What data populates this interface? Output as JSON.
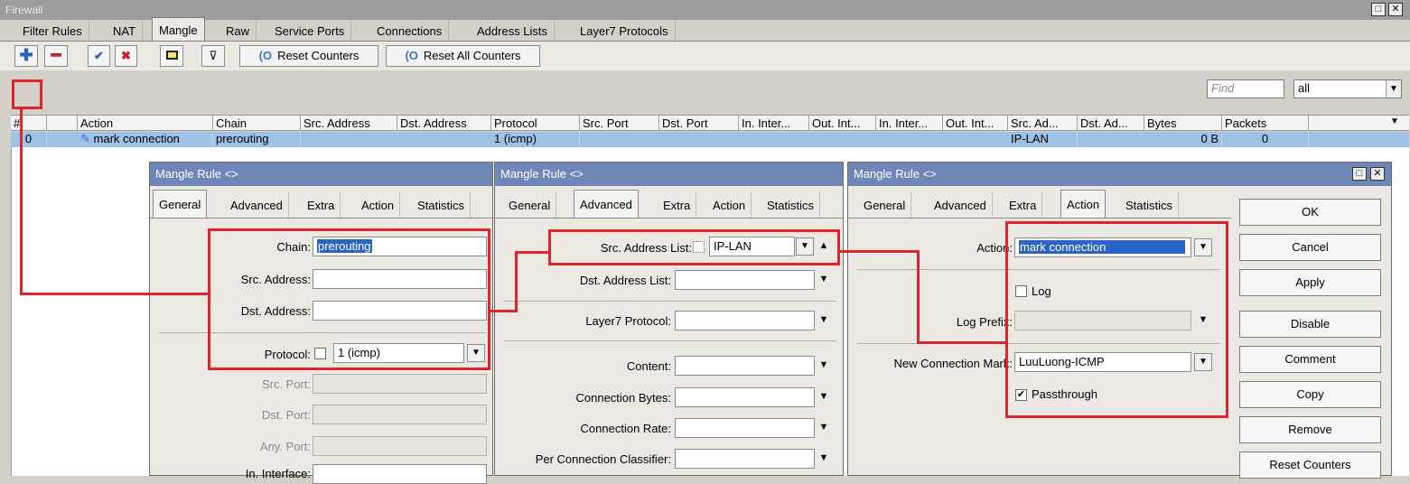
{
  "window": {
    "title": "Firewall",
    "restore_icon": "restore-icon",
    "close_icon": "close-icon"
  },
  "tabs": [
    "Filter Rules",
    "NAT",
    "Mangle",
    "Raw",
    "Service Ports",
    "Connections",
    "Address Lists",
    "Layer7 Protocols"
  ],
  "active_tab": "Mangle",
  "toolbar": {
    "reset_counters": "Reset Counters",
    "reset_all_counters": "Reset All Counters",
    "find_placeholder": "Find",
    "filter_value": "all"
  },
  "list": {
    "columns": [
      "#",
      "Action",
      "Chain",
      "Src. Address",
      "Dst. Address",
      "Protocol",
      "Src. Port",
      "Dst. Port",
      "In. Inter...",
      "Out. Int...",
      "In. Inter...",
      "Out. Int...",
      "Src. Ad...",
      "Dst. Ad...",
      "Bytes",
      "Packets"
    ],
    "rows": [
      {
        "num": "0",
        "action": "mark connection",
        "chain": "prerouting",
        "protocol": "1 (icmp)",
        "src_address_list": "IP-LAN",
        "bytes": "0 B",
        "packets": "0"
      }
    ]
  },
  "dialog_general": {
    "title": "Mangle Rule <>",
    "tabs": [
      "General",
      "Advanced",
      "Extra",
      "Action",
      "Statistics"
    ],
    "chain_label": "Chain:",
    "chain_value": "prerouting",
    "src_address_label": "Src. Address:",
    "dst_address_label": "Dst. Address:",
    "protocol_label": "Protocol:",
    "protocol_value": "1 (icmp)",
    "src_port_label": "Src. Port:",
    "dst_port_label": "Dst. Port:",
    "any_port_label": "Any. Port:",
    "in_interface_label": "In. Interface:"
  },
  "dialog_advanced": {
    "title": "Mangle Rule <>",
    "tabs": [
      "General",
      "Advanced",
      "Extra",
      "Action",
      "Statistics"
    ],
    "src_address_list_label": "Src. Address List:",
    "src_address_list_value": "IP-LAN",
    "dst_address_list_label": "Dst. Address List:",
    "layer7_label": "Layer7 Protocol:",
    "content_label": "Content:",
    "connection_bytes_label": "Connection Bytes:",
    "connection_rate_label": "Connection Rate:",
    "pcc_label": "Per Connection Classifier:"
  },
  "dialog_action": {
    "title": "Mangle Rule <>",
    "tabs": [
      "General",
      "Advanced",
      "Extra",
      "Action",
      "Statistics"
    ],
    "action_label": "Action:",
    "action_value": "mark connection",
    "log_label": "Log",
    "log_prefix_label": "Log Prefix:",
    "new_connection_mark_label": "New Connection Mark:",
    "new_connection_mark_value": "LuuLuong-ICMP",
    "passthrough_label": "Passthrough",
    "buttons": [
      "OK",
      "Cancel",
      "Apply",
      "Disable",
      "Comment",
      "Copy",
      "Remove",
      "Reset Counters"
    ]
  },
  "colors": {
    "highlight": "#e0242d",
    "selection": "#9ec1e8",
    "dialog_title": "#6f86b8"
  }
}
